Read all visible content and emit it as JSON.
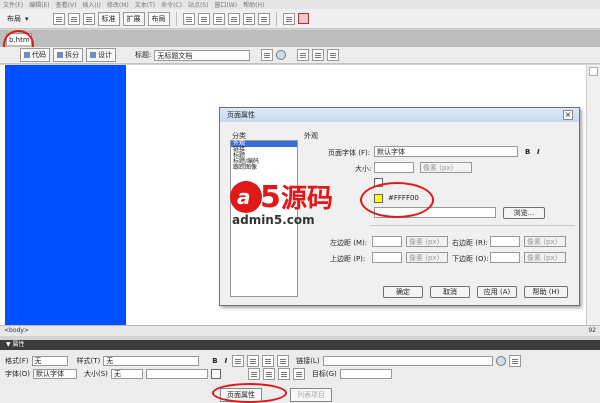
{
  "menubar": [
    "文件(F)",
    "编辑(E)",
    "查看(V)",
    "插入(I)",
    "修改(M)",
    "文本(T)",
    "命令(C)",
    "站点(S)",
    "窗口(W)",
    "帮助(H)"
  ],
  "toolbar1": {
    "layout_dropdown": "布局",
    "modes": [
      "标准",
      "扩展",
      "布局"
    ]
  },
  "document": {
    "tab_name": "b.htm",
    "view_buttons": [
      "代码",
      "拆分",
      "设计"
    ],
    "title_label": "标题:",
    "title_value": "无标题文档"
  },
  "statusbar": {
    "tag": "<body>",
    "right": "92"
  },
  "properties": {
    "header": "▼ 属性",
    "format_label": "格式(F)",
    "format_value": "无",
    "style_label": "样式(T)",
    "style_value": "无",
    "bold": "B",
    "italic": "I",
    "link_label": "链接(L)",
    "font_label": "字体(O)",
    "font_value": "默认字体",
    "size_label": "大小(S)",
    "size_value": "无",
    "target_label": "目标(G)",
    "page_props_button": "页面属性",
    "list_item_button": "列表项目"
  },
  "dialog": {
    "title": "页面属性",
    "category_label": "分类",
    "categories": [
      "外观",
      "链接",
      "标题",
      "标题/编码",
      "跟踪图像"
    ],
    "selected_category": 0,
    "section_title": "外观",
    "font_label": "页面字体 (F):",
    "font_value": "默认字体",
    "bold": "B",
    "italic": "I",
    "size_label": "大小:",
    "unit_placeholder": "像素 (px)",
    "text_color_value": "#FFFF00",
    "browse_button": "浏览...",
    "margin_left_label": "左边距 (M):",
    "margin_right_label": "右边距 (R):",
    "margin_top_label": "上边距 (P):",
    "margin_bottom_label": "下边距 (O):",
    "ok_button": "确定",
    "cancel_button": "取消",
    "apply_button": "应用 (A)",
    "help_button": "帮助 (H)"
  },
  "watermark": {
    "logo": "a5",
    "brand": "源码",
    "url": "admin5.com"
  },
  "colors": {
    "canvas_blue": "#0050ff",
    "annotation_red": "#e01818",
    "text_color_swatch": "#ffff00"
  }
}
